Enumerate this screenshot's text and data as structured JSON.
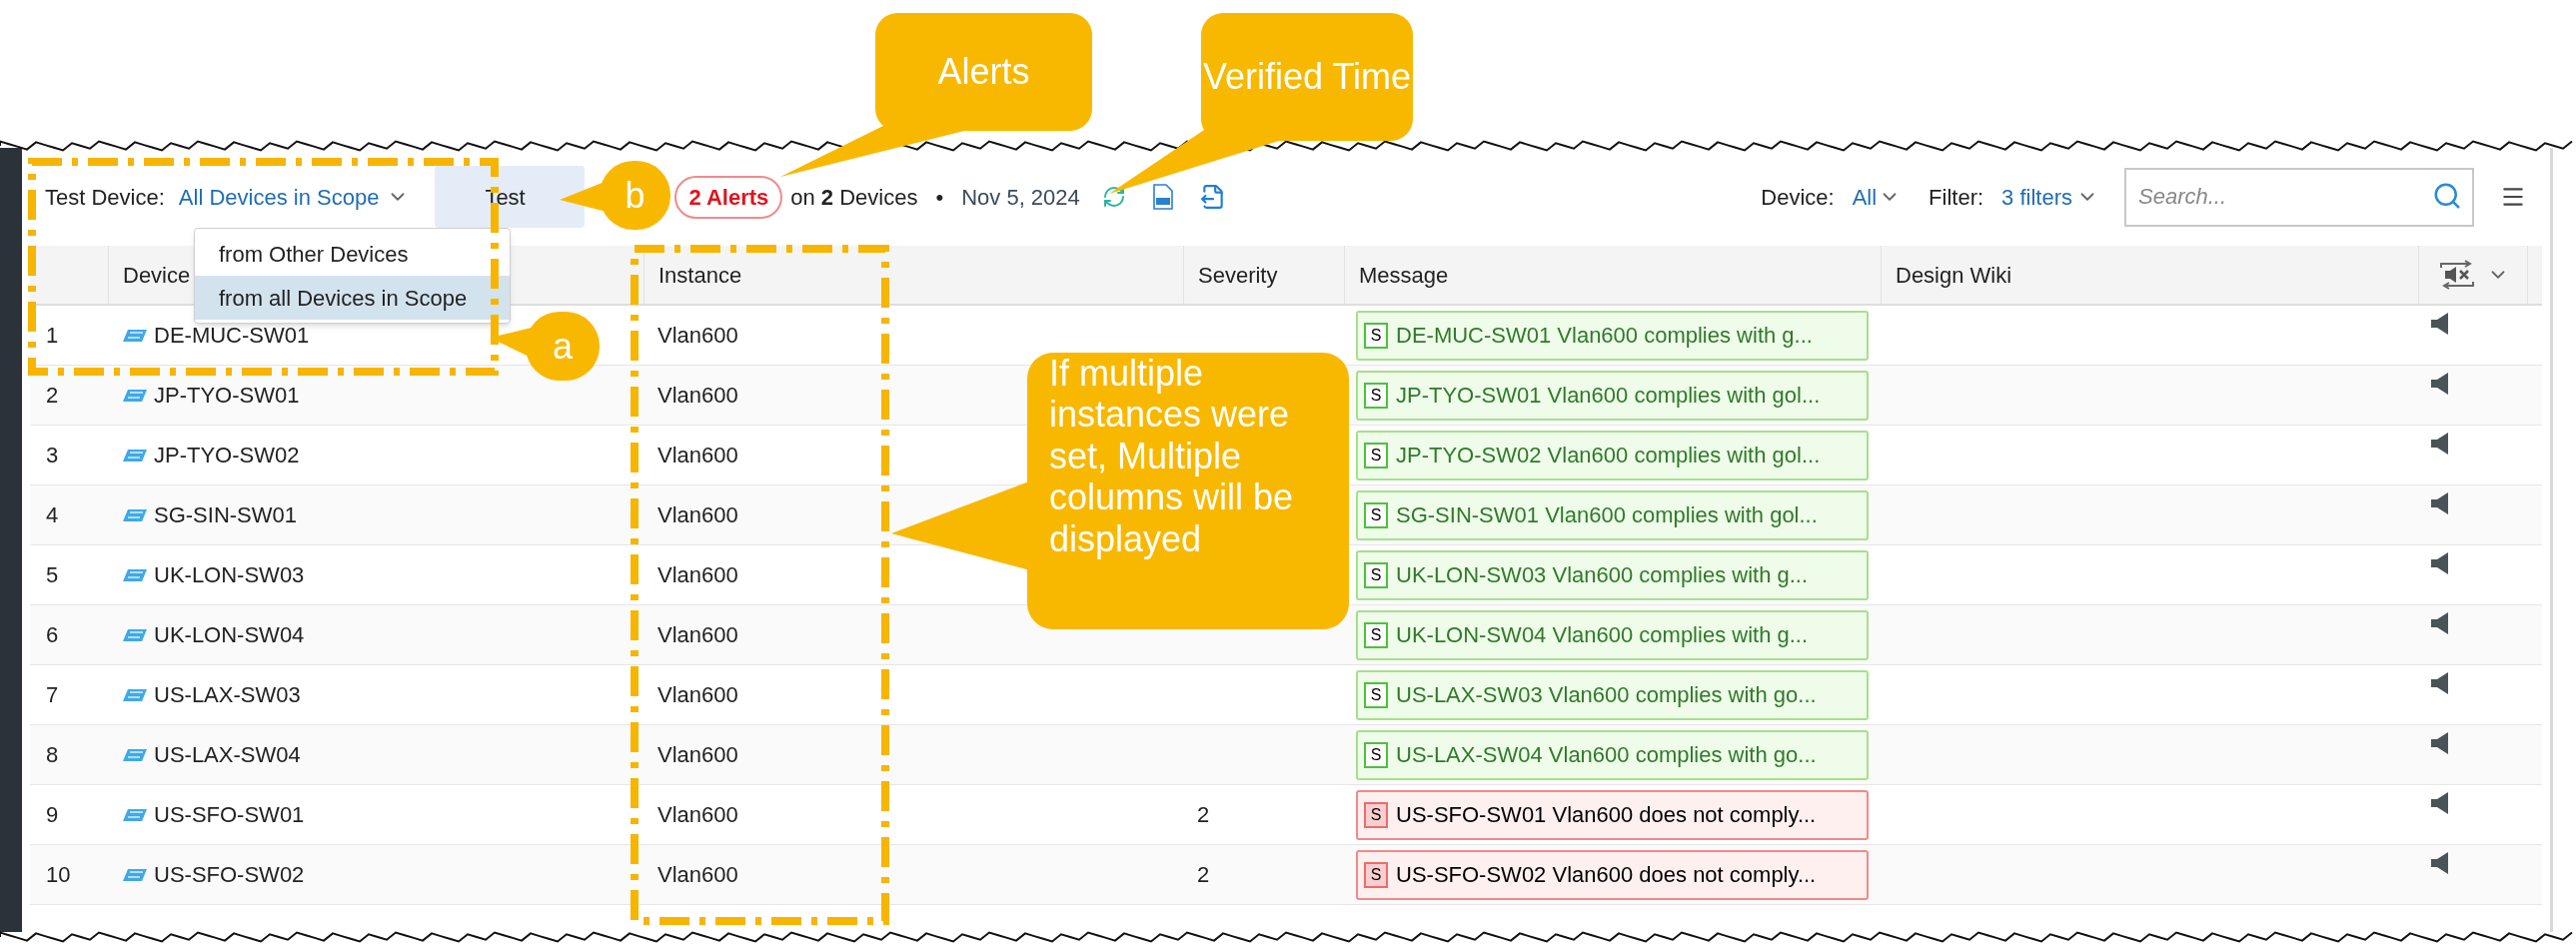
{
  "toolbar": {
    "test_device_label": "Test Device:",
    "scope": "All Devices in Scope",
    "test_button": "Test",
    "alerts": "2 Alerts",
    "summary": "on **2** Devices",
    "separator": "•",
    "verified_time": "Nov 5, 2024",
    "device_label": "Device:",
    "device_value": "All",
    "filter_label": "Filter:",
    "filter_value": "3 filters",
    "search": {
      "placeholder": "Search..."
    }
  },
  "scope_menu": [
    {
      "label": "from Other Devices",
      "selected": false
    },
    {
      "label": "from all Devices in Scope",
      "selected": true
    }
  ],
  "table": {
    "columns": [
      "Device",
      "Instance",
      "Severity",
      "Message",
      "Design Wiki"
    ],
    "rows": [
      {
        "index": "1",
        "device": "DE-MUC-SW01",
        "instance": "Vlan600",
        "badge": "S",
        "message": "DE-MUC-SW01 Vlan600 complies with g...",
        "kind": "pass"
      },
      {
        "index": "2",
        "device": "JP-TYO-SW01",
        "instance": "Vlan600",
        "badge": "S",
        "message": "JP-TYO-SW01 Vlan600 complies with gol...",
        "kind": "pass"
      },
      {
        "index": "3",
        "device": "JP-TYO-SW02",
        "instance": "Vlan600",
        "badge": "S",
        "message": "JP-TYO-SW02 Vlan600 complies with gol...",
        "kind": "pass"
      },
      {
        "index": "4",
        "device": "SG-SIN-SW01",
        "instance": "Vlan600",
        "badge": "S",
        "message": "SG-SIN-SW01 Vlan600 complies with gol...",
        "kind": "pass"
      },
      {
        "index": "5",
        "device": "UK-LON-SW03",
        "instance": "Vlan600",
        "badge": "S",
        "message": "UK-LON-SW03 Vlan600 complies with g...",
        "kind": "pass"
      },
      {
        "index": "6",
        "device": "UK-LON-SW04",
        "instance": "Vlan600",
        "badge": "S",
        "message": "UK-LON-SW04 Vlan600 complies with g...",
        "kind": "pass"
      },
      {
        "index": "7",
        "device": "US-LAX-SW03",
        "instance": "Vlan600",
        "badge": "S",
        "message": "US-LAX-SW03 Vlan600 complies with go...",
        "kind": "pass"
      },
      {
        "index": "8",
        "device": "US-LAX-SW04",
        "instance": "Vlan600",
        "badge": "S",
        "message": "US-LAX-SW04 Vlan600 complies with go...",
        "kind": "pass"
      },
      {
        "index": "9",
        "device": "US-SFO-SW01",
        "instance": "Vlan600",
        "severity": "2",
        "badge": "S",
        "message": "US-SFO-SW01 Vlan600 does not comply...",
        "kind": "fail"
      },
      {
        "index": "10",
        "device": "US-SFO-SW02",
        "instance": "Vlan600",
        "severity": "2",
        "badge": "S",
        "message": "US-SFO-SW02 Vlan600 does not comply...",
        "kind": "fail"
      }
    ]
  },
  "annotations": [
    {
      "text": "Alerts"
    },
    {
      "text": "Verified Time"
    },
    {
      "text": "b"
    },
    {
      "text": "a"
    },
    {
      "text": "If multiple instances were set, Multiple columns will be displayed"
    }
  ]
}
